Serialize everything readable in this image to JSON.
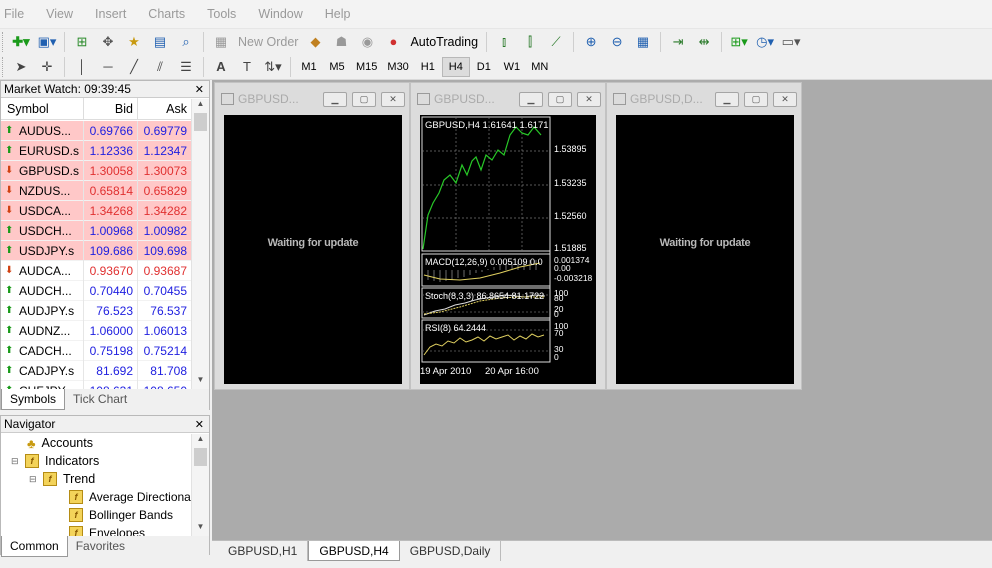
{
  "menu": [
    "File",
    "View",
    "Insert",
    "Charts",
    "Tools",
    "Window",
    "Help"
  ],
  "toolbar": {
    "new_order": "New Order",
    "autotrading": "AutoTrading",
    "timeframes": [
      "M1",
      "M5",
      "M15",
      "M30",
      "H1",
      "H4",
      "D1",
      "W1",
      "MN"
    ],
    "active_timeframe": "H4"
  },
  "market_watch": {
    "title": "Market Watch: 09:39:45",
    "col_symbol": "Symbol",
    "col_bid": "Bid",
    "col_ask": "Ask",
    "rows": [
      {
        "symbol": "AUDUS...",
        "bid": "0.69766",
        "ask": "0.69779",
        "dir": "up",
        "hl": true
      },
      {
        "symbol": "EURUSD.s",
        "bid": "1.12336",
        "ask": "1.12347",
        "dir": "up",
        "hl": true
      },
      {
        "symbol": "GBPUSD.s",
        "bid": "1.30058",
        "ask": "1.30073",
        "dir": "dn",
        "hl": true
      },
      {
        "symbol": "NZDUS...",
        "bid": "0.65814",
        "ask": "0.65829",
        "dir": "dn",
        "hl": true
      },
      {
        "symbol": "USDCA...",
        "bid": "1.34268",
        "ask": "1.34282",
        "dir": "dn",
        "hl": true
      },
      {
        "symbol": "USDCH...",
        "bid": "1.00968",
        "ask": "1.00982",
        "dir": "up",
        "hl": true
      },
      {
        "symbol": "USDJPY.s",
        "bid": "109.686",
        "ask": "109.698",
        "dir": "up",
        "hl": true
      },
      {
        "symbol": "AUDCA...",
        "bid": "0.93670",
        "ask": "0.93687",
        "dir": "dn",
        "hl": false
      },
      {
        "symbol": "AUDCH...",
        "bid": "0.70440",
        "ask": "0.70455",
        "dir": "up",
        "hl": false
      },
      {
        "symbol": "AUDJPY.s",
        "bid": "76.523",
        "ask": "76.537",
        "dir": "up",
        "hl": false
      },
      {
        "symbol": "AUDNZ...",
        "bid": "1.06000",
        "ask": "1.06013",
        "dir": "up",
        "hl": false
      },
      {
        "symbol": "CADCH...",
        "bid": "0.75198",
        "ask": "0.75214",
        "dir": "up",
        "hl": false
      },
      {
        "symbol": "CADJPY.s",
        "bid": "81.692",
        "ask": "81.708",
        "dir": "up",
        "hl": false
      },
      {
        "symbol": "CHFJPY...",
        "bid": "108.631",
        "ask": "108.650",
        "dir": "up",
        "hl": false
      }
    ],
    "tabs": [
      "Symbols",
      "Tick Chart"
    ]
  },
  "navigator": {
    "title": "Navigator",
    "items": [
      "Accounts",
      "Indicators",
      "Trend",
      "Average Directiona",
      "Bollinger Bands",
      "Envelopes"
    ],
    "tabs": [
      "Common",
      "Favorites"
    ]
  },
  "charts": [
    {
      "title": "GBPUSD...",
      "waiting": "Waiting for update"
    },
    {
      "title": "GBPUSD...",
      "header": "GBPUSD,H4  1.61641 1.6171",
      "prices": [
        "1.53895",
        "1.53235",
        "1.52560",
        "1.51885"
      ],
      "macd": "MACD(12,26,9) 0.005109 0.0",
      "macd_levels": [
        "0.001374",
        "0.00",
        "-0.003218"
      ],
      "stoch": "Stoch(8,3,3) 86.8654 81.1722",
      "stoch_levels": [
        "100",
        "80",
        "20",
        "0"
      ],
      "rsi": "RSI(8) 64.2444",
      "rsi_levels": [
        "100",
        "70",
        "30",
        "0"
      ],
      "dates": [
        "19 Apr 2010",
        "20 Apr 16:00"
      ]
    },
    {
      "title": "GBPUSD,D...",
      "waiting": "Waiting for update"
    }
  ],
  "bottom_tabs": [
    "GBPUSD,H1",
    "GBPUSD,H4",
    "GBPUSD,Daily"
  ]
}
